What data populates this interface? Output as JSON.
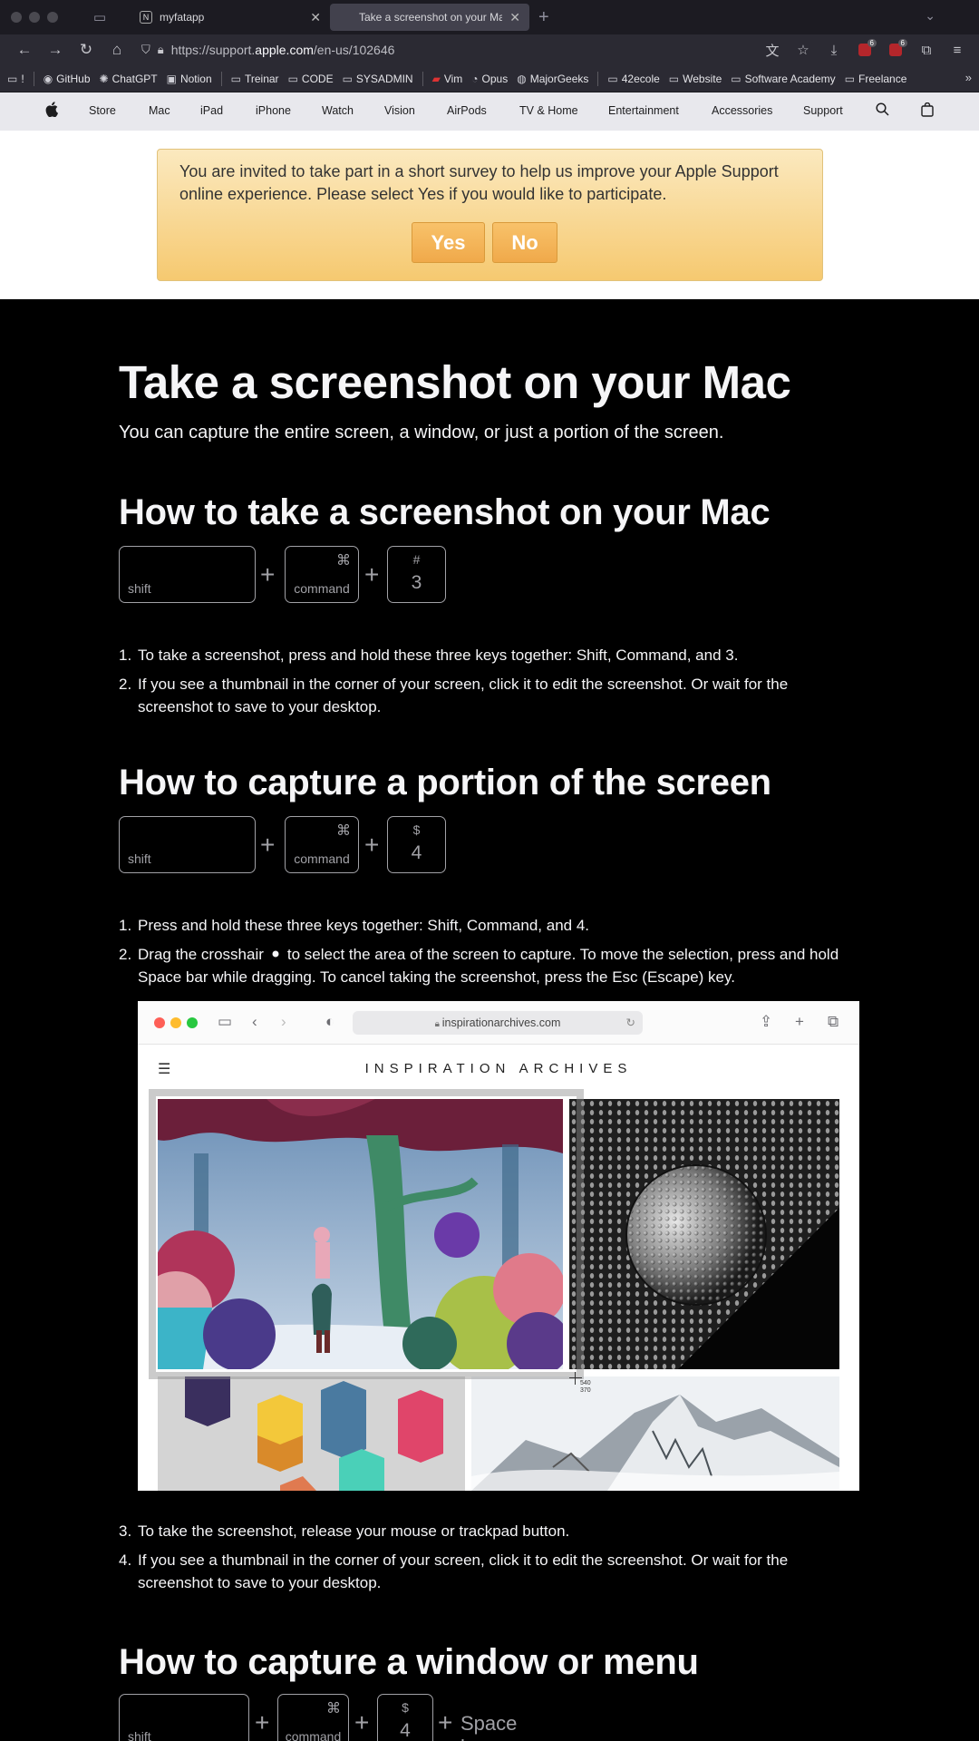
{
  "browser": {
    "tabs": [
      {
        "title": "myfatapp",
        "favicon": "N",
        "active": false
      },
      {
        "title": "Take a screenshot on your Mac",
        "favicon": "apple",
        "active": true
      }
    ],
    "url_prefix": "https://support.",
    "url_host": "apple.com",
    "url_path": "/en-us/102646",
    "ext_badges": [
      "6",
      "6"
    ],
    "bookmarks": [
      "GitHub",
      "ChatGPT",
      "Notion",
      "Treinar",
      "CODE",
      "SYSADMIN",
      "Vim",
      "Opus",
      "MajorGeeks",
      "42ecole",
      "Website",
      "Software Academy",
      "Freelance"
    ]
  },
  "apple_nav": {
    "items": [
      "Store",
      "Mac",
      "iPad",
      "iPhone",
      "Watch",
      "Vision",
      "AirPods",
      "TV & Home",
      "Entertainment",
      "Accessories",
      "Support"
    ]
  },
  "survey": {
    "message": "You are invited to take part in a short survey to help us improve your Apple Support online experience. Please select Yes if you would like to participate.",
    "yes_label": "Yes",
    "no_label": "No"
  },
  "article": {
    "title": "Take a screenshot on your Mac",
    "intro": "You can capture the entire screen, a window, or just a portion of the screen.",
    "section1": {
      "heading": "How to take a screenshot on your Mac",
      "keys": {
        "shift": "shift",
        "cmd_symbol": "⌘",
        "command": "command",
        "top": "#",
        "num": "3"
      },
      "steps": [
        "To take a screenshot, press and hold these three keys together: Shift, Command, and 3.",
        "If you see a thumbnail in the corner of your screen, click it to edit the screenshot. Or wait for the screenshot to save to your desktop."
      ]
    },
    "section2": {
      "heading": "How to capture a portion of the screen",
      "keys": {
        "shift": "shift",
        "cmd_symbol": "⌘",
        "command": "command",
        "top": "$",
        "num": "4"
      },
      "steps_before": [
        "Press and hold these three keys together: Shift, Command, and 4.",
        "Drag the crosshair",
        "to select the area of the screen to capture. To move the selection, press and hold Space bar while dragging. To cancel taking the screenshot, press the Esc (Escape) key."
      ],
      "steps_after": [
        "To take the screenshot, release your mouse or trackpad button.",
        "If you see a thumbnail in the corner of your screen, click it to edit the screenshot. Or wait for the screenshot to save to your desktop."
      ]
    },
    "section3": {
      "heading": "How to capture a window or menu",
      "keys": {
        "shift": "shift",
        "cmd_symbol": "⌘",
        "command": "command",
        "top": "$",
        "num": "4",
        "extra": "Space bar"
      }
    }
  },
  "embedded_image": {
    "url": "inspirationarchives.com",
    "site_title": "INSPIRATION ARCHIVES",
    "coord_x": "540",
    "coord_y": "370"
  },
  "plus": "+"
}
